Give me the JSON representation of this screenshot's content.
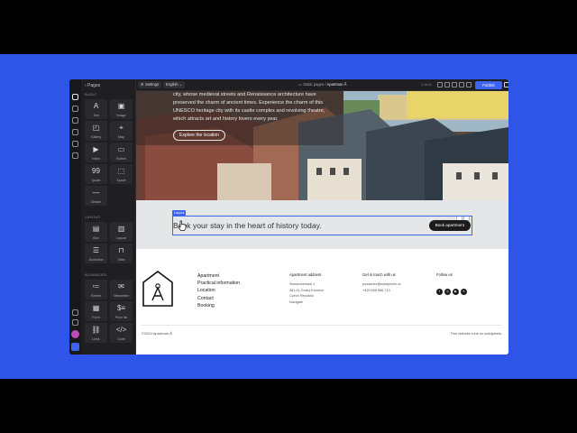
{
  "panel": {
    "back_label": "‹ Pages",
    "sections": [
      {
        "label": "BASIC",
        "tiles": [
          {
            "label": "Text",
            "icon": "text-icon",
            "glyph": "A"
          },
          {
            "label": "Image",
            "icon": "image-icon",
            "glyph": "▣"
          },
          {
            "label": "Gallery",
            "icon": "gallery-icon",
            "glyph": "◰"
          },
          {
            "label": "Map",
            "icon": "map-pin-icon",
            "glyph": "⌖"
          },
          {
            "label": "Video",
            "icon": "video-icon",
            "glyph": "▶"
          },
          {
            "label": "Button",
            "icon": "button-icon",
            "glyph": "▭"
          },
          {
            "label": "Quote",
            "icon": "quote-icon",
            "glyph": "99"
          },
          {
            "label": "Space",
            "icon": "space-icon",
            "glyph": "⬚"
          },
          {
            "label": "Divider",
            "icon": "divider-icon",
            "glyph": "—"
          }
        ]
      },
      {
        "label": "LAYOUT",
        "tiles": [
          {
            "label": "Box",
            "icon": "box-icon",
            "glyph": "▤"
          },
          {
            "label": "Layout",
            "icon": "layout-icon",
            "glyph": "▥"
          },
          {
            "label": "Accordion",
            "icon": "accordion-icon",
            "glyph": "☰"
          },
          {
            "label": "Tabs",
            "icon": "tabs-icon",
            "glyph": "⊓"
          }
        ]
      },
      {
        "label": "ADVANCED",
        "tiles": [
          {
            "label": "Entries",
            "icon": "entries-icon",
            "glyph": "≔"
          },
          {
            "label": "Newsletter",
            "icon": "newsletter-icon",
            "glyph": "✉"
          },
          {
            "label": "Form",
            "icon": "form-icon",
            "glyph": "▦"
          },
          {
            "label": "Price list",
            "icon": "price-list-icon",
            "glyph": "$≡"
          },
          {
            "label": "Links",
            "icon": "links-icon",
            "glyph": "⛓"
          },
          {
            "label": "Code",
            "icon": "code-icon",
            "glyph": "</>"
          }
        ]
      }
    ]
  },
  "toolbar": {
    "settings_label": "Settings",
    "language_label": "English",
    "breadcrumb_section": "Static pages",
    "breadcrumb_separator": "/",
    "breadcrumb_page": "Apartman Å",
    "zoom": "1:16:41",
    "publish_label": "Publish"
  },
  "hero": {
    "text": "city, whose medieval streets and Renaissance architecture have preserved the charm of ancient times. Experience the charm of this UNESCO heritage city with its castle complex and revolving theatre, which attracts art and history lovers every year.",
    "button_label": "Explore the location"
  },
  "booking": {
    "section_tag": "Layout",
    "headline": "Book your stay in the heart of history today.",
    "button_label": "Book apartment"
  },
  "footer": {
    "nav": [
      "Apartment",
      "Practical information",
      "Location",
      "Contact",
      "Booking"
    ],
    "address_heading": "Apartment address",
    "address_lines": [
      "Starorobertská 1",
      "381 01 Český Krumlov",
      "Czech Republic",
      "Navigate"
    ],
    "contact_heading": "Get in touch with us",
    "contact_lines": [
      "pozdanez@solidpixels.cz",
      "+420 606 586 710"
    ],
    "follow_heading": "Follow us",
    "social": [
      {
        "icon": "facebook-icon",
        "glyph": "f"
      },
      {
        "icon": "instagram-icon",
        "glyph": "◎"
      },
      {
        "icon": "youtube-icon",
        "glyph": "▶"
      },
      {
        "icon": "x-icon",
        "glyph": "✕"
      }
    ],
    "copyright": "©2024 Apartman Å",
    "runs_on": "This website runs on solidpixels."
  },
  "colors": {
    "accent": "#3d63f2",
    "background_outer": "#2f55e8",
    "panel": "#1f1f21"
  }
}
